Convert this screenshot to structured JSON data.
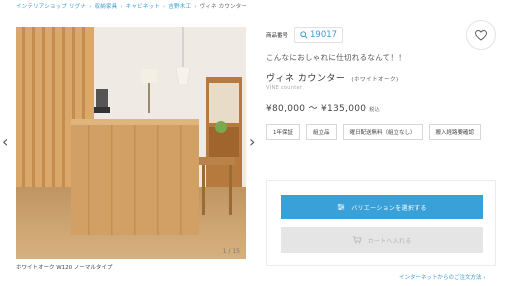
{
  "breadcrumb": {
    "items": [
      "インテリアショップ リグナ",
      "収納家具",
      "キャビネット",
      "吉野木工"
    ],
    "current": "ヴィネ カウンター"
  },
  "gallery": {
    "counter": "1 / 15",
    "caption": "ホワイトオーク W120 ノーマルタイプ"
  },
  "product": {
    "code_label": "商品番号",
    "code": "19017",
    "catch_copy": "こんなにおしゃれに仕切れるなんて！！",
    "name": "ヴィネ カウンター",
    "variant": "(ホワイトオーク)",
    "name_en": "VINE counter",
    "price": "¥80,000 〜 ¥135,000",
    "tax_note": "税込"
  },
  "tags": [
    "1年保証",
    "組立品",
    "曜日配送無料（組立なし）",
    "搬入経路要確認"
  ],
  "cart": {
    "variation_button": "バリエーションを選択する",
    "cart_button": "カートへ入れる"
  },
  "links": {
    "internet_order": "インターネットからのご注文方法 ›"
  },
  "colors": {
    "accent": "#3aa0d8",
    "disabled": "#e5e5e5"
  },
  "icons": [
    "search-icon",
    "heart-icon",
    "chevron-left-icon",
    "chevron-right-icon",
    "settings-icon",
    "cart-icon"
  ]
}
